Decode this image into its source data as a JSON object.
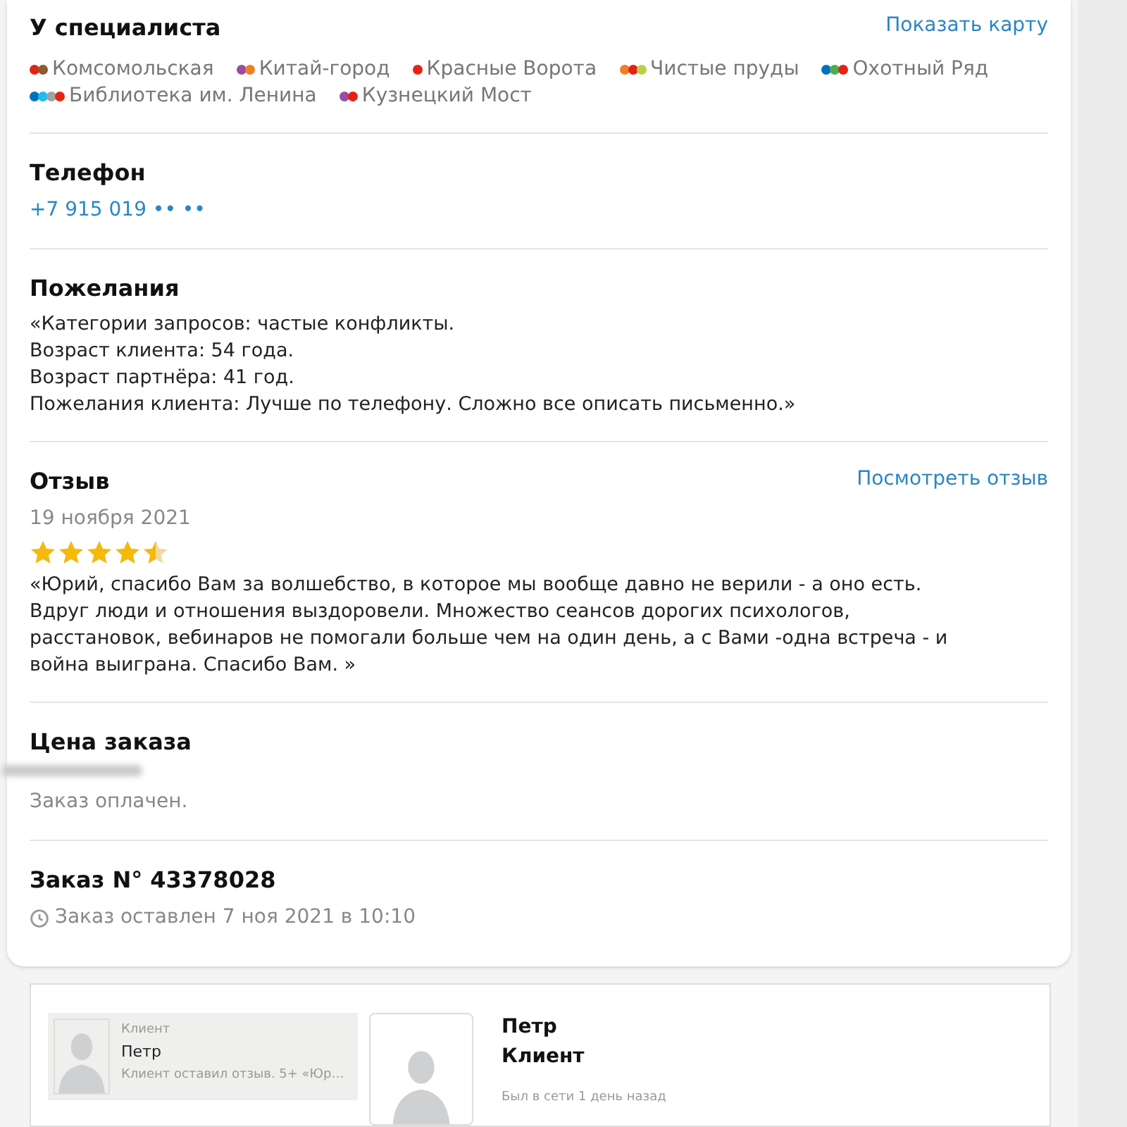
{
  "specialist": {
    "title": "У специалиста",
    "map_link": "Показать карту",
    "stations": [
      {
        "name": "Комсомольская",
        "lines": [
          {
            "color": "#e42313"
          },
          {
            "color": "#8d5b2d"
          }
        ]
      },
      {
        "name": "Китай-город",
        "lines": [
          {
            "color": "#9a4d9e"
          },
          {
            "color": "#f07e24"
          }
        ]
      },
      {
        "name": "Красные Ворота",
        "lines": [
          {
            "color": "#e42313"
          }
        ]
      },
      {
        "name": "Чистые пруды",
        "lines": [
          {
            "color": "#f07e24"
          },
          {
            "color": "#e42313"
          },
          {
            "color": "#b4d445"
          }
        ]
      },
      {
        "name": "Охотный Ряд",
        "lines": [
          {
            "color": "#0072ba"
          },
          {
            "color": "#4baf4f"
          },
          {
            "color": "#e42313"
          }
        ]
      },
      {
        "name": "Библиотека им. Ленина",
        "lines": [
          {
            "color": "#0072ba"
          },
          {
            "color": "#1ebcef"
          },
          {
            "color": "#a1a2a3"
          },
          {
            "color": "#e42313"
          }
        ]
      },
      {
        "name": "Кузнецкий Мост",
        "lines": [
          {
            "color": "#9a4d9e"
          },
          {
            "color": "#e42313"
          }
        ]
      }
    ]
  },
  "phone": {
    "title": "Телефон",
    "number": "+7 915 019 •• ••"
  },
  "wishes": {
    "title": "Пожелания",
    "lines": [
      "«Категории запросов: частые конфликты.",
      "Возраст клиента: 54 года.",
      "Возраст партнёра: 41 год.",
      "Пожелания клиента: Лучше по телефону. Сложно все описать письменно.»"
    ]
  },
  "review": {
    "title": "Отзыв",
    "link": "Посмотреть отзыв",
    "date": "19 ноября 2021",
    "stars": 4.5,
    "text": "«Юрий, спасибо Вам за волшебство, в которое мы вообще давно не верили - а оно есть. Вдруг люди и отношения выздоровели. Множество сеансов дорогих психологов, расстановок, вебинаров не помогали больше чем на один день, а с Вами -одна встреча - и война выиграна. Спасибо Вам. »"
  },
  "price": {
    "title": "Цена заказа",
    "status": "Заказ оплачен."
  },
  "order": {
    "title": "Заказ N° 43378028",
    "created": "Заказ оставлен 7 ноя 2021 в 10:10"
  },
  "chat": {
    "dialog": {
      "role": "Клиент",
      "name": "Петр",
      "preview": "Клиент оставил отзыв. 5+ «Юр…",
      "selected": true
    },
    "profile": {
      "name": "Петр",
      "role": "Клиент",
      "last_seen": "Был в сети 1 день назад"
    }
  }
}
